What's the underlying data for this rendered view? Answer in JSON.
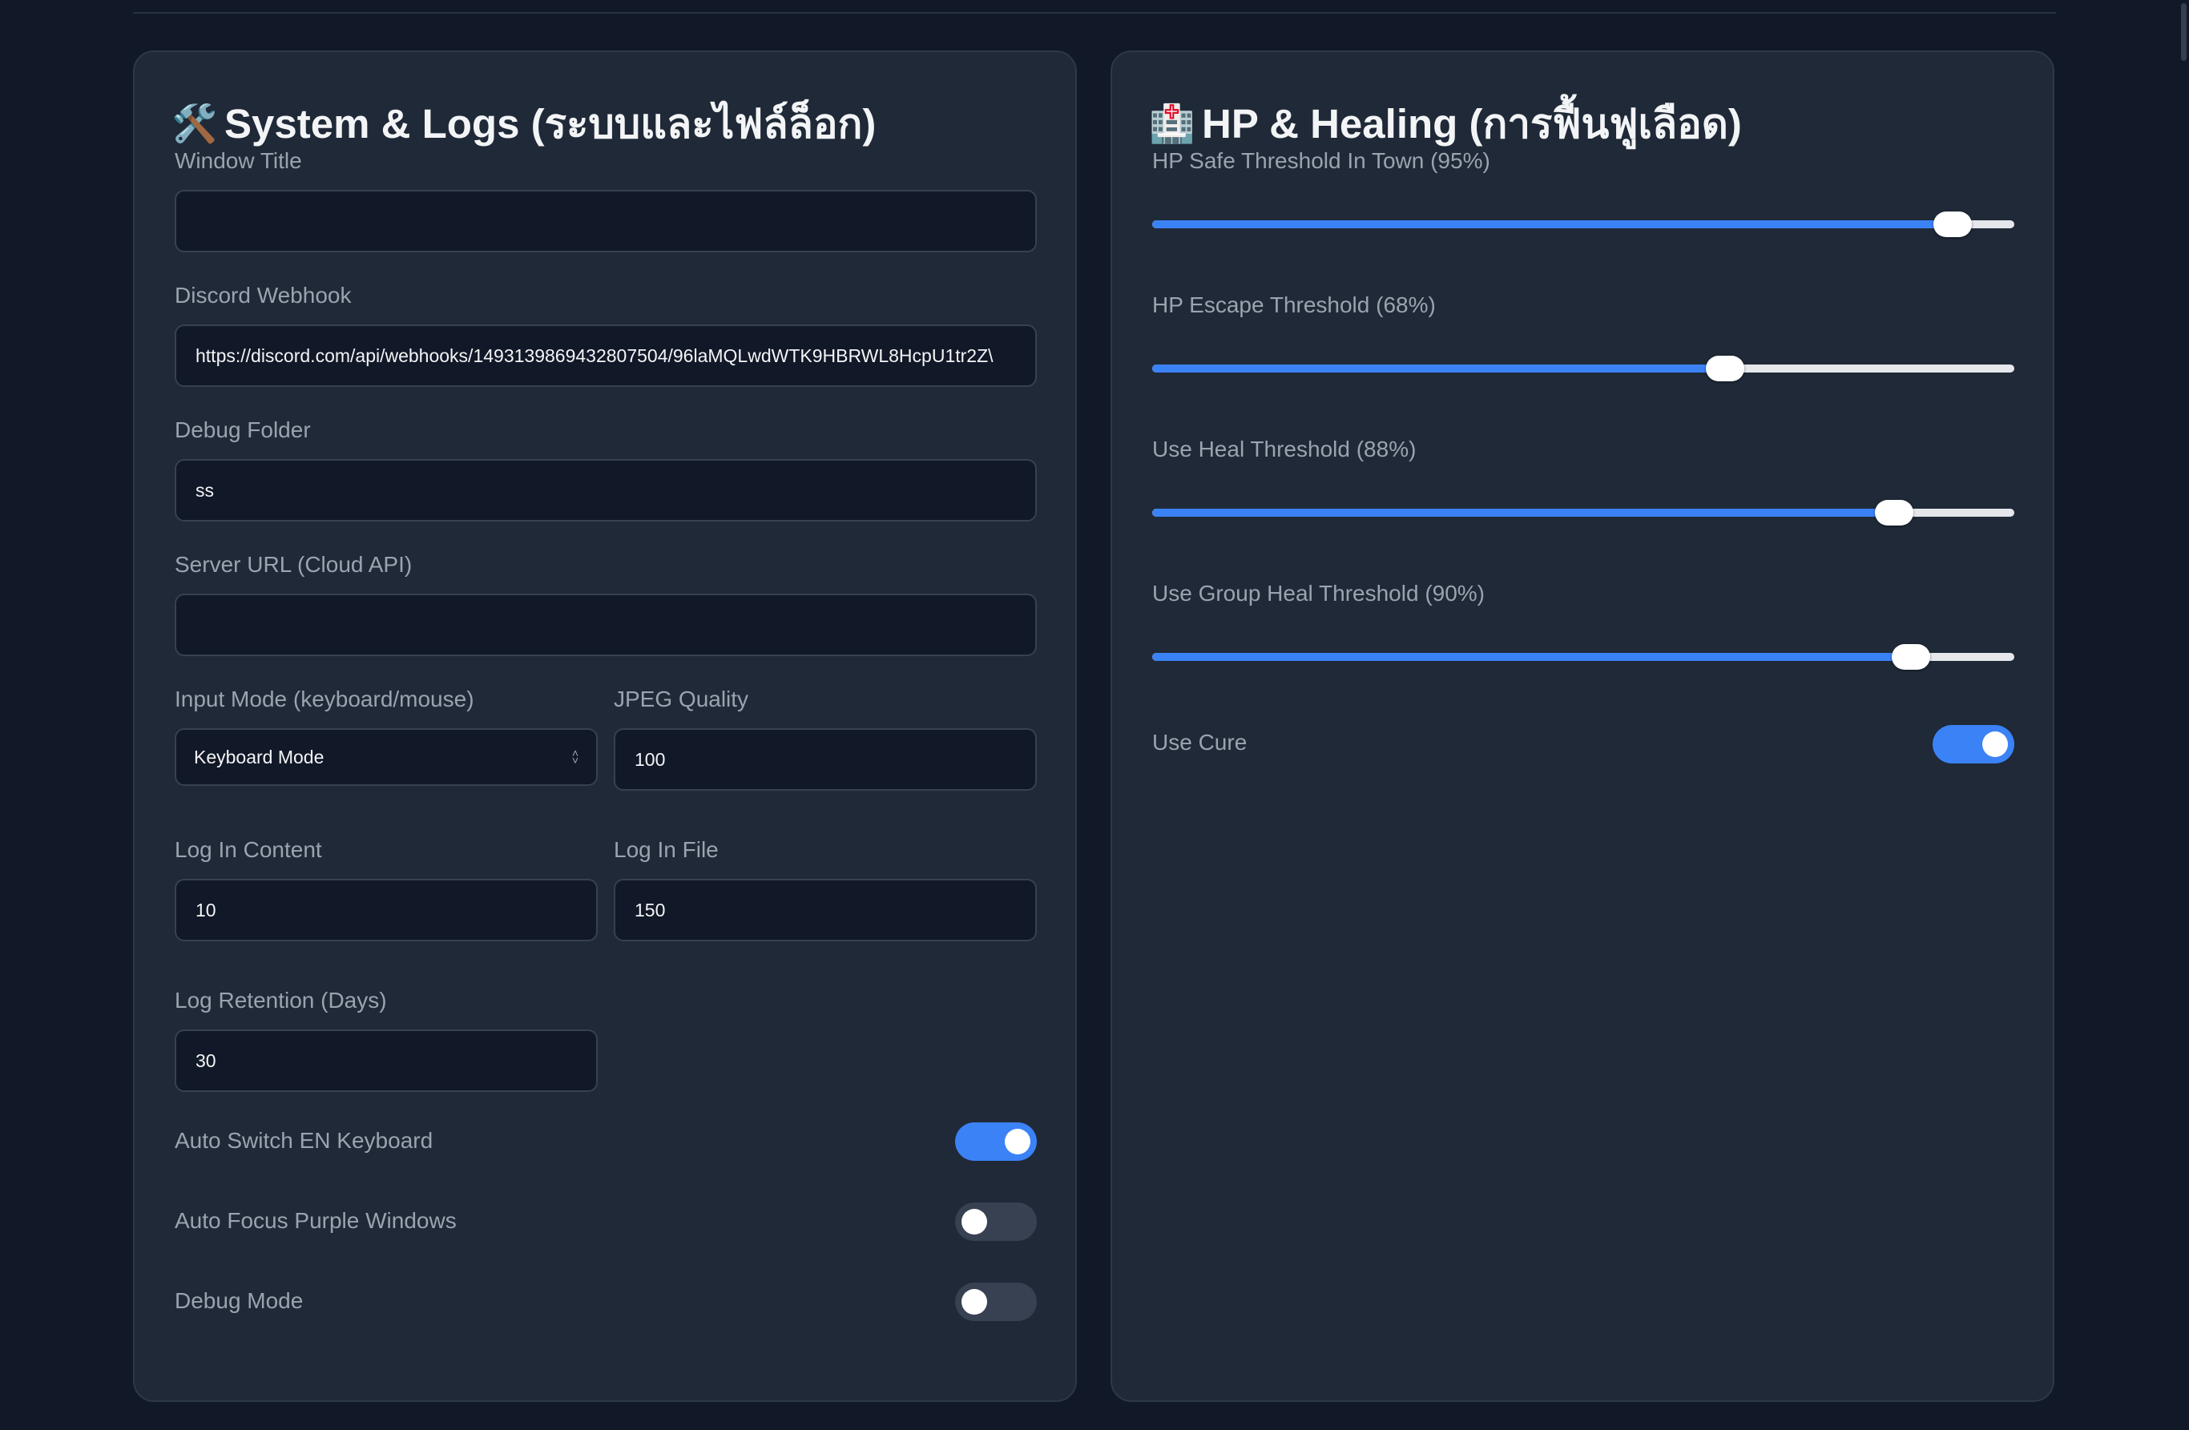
{
  "system": {
    "title": "System & Logs (ระบบและไฟล์ล็อก)",
    "title_icon": "hammer-and-wrench-icon",
    "title_icon_glyph": "🛠️",
    "window_title": {
      "label": "Window Title",
      "value": ""
    },
    "discord_webhook": {
      "label": "Discord Webhook",
      "value": "https://discord.com/api/webhooks/1493139869432807504/96laMQLwdWTK9HBRWL8HcpU1tr2Z\\"
    },
    "debug_folder": {
      "label": "Debug Folder",
      "value": "ss"
    },
    "server_url": {
      "label": "Server URL (Cloud API)",
      "value": ""
    },
    "input_mode": {
      "label": "Input Mode (keyboard/mouse)",
      "value": "Keyboard Mode"
    },
    "jpeg_quality": {
      "label": "JPEG Quality",
      "value": "100"
    },
    "log_in_content": {
      "label": "Log In Content",
      "value": "10"
    },
    "log_in_file": {
      "label": "Log In File",
      "value": "150"
    },
    "log_retention": {
      "label": "Log Retention (Days)",
      "value": "30"
    },
    "auto_switch_en_keyboard": {
      "label": "Auto Switch EN Keyboard",
      "on": true
    },
    "auto_focus_purple_windows": {
      "label": "Auto Focus Purple Windows",
      "on": false
    },
    "debug_mode": {
      "label": "Debug Mode",
      "on": false
    }
  },
  "hp": {
    "title": "HP & Healing (การฟื้นฟูเลือด)",
    "title_icon": "hospital-icon",
    "title_icon_glyph": "🏥",
    "sliders": [
      {
        "label": "HP Safe Threshold In Town (95%)",
        "value": 95
      },
      {
        "label": "HP Escape Threshold (68%)",
        "value": 68
      },
      {
        "label": "Use Heal Threshold (88%)",
        "value": 88
      },
      {
        "label": "Use Group Heal Threshold (90%)",
        "value": 90
      }
    ],
    "use_cure": {
      "label": "Use Cure",
      "on": true
    }
  },
  "colors": {
    "background": "#111827",
    "panel": "#1f2937",
    "accent": "#3b82f6",
    "input_bg": "#111827"
  }
}
